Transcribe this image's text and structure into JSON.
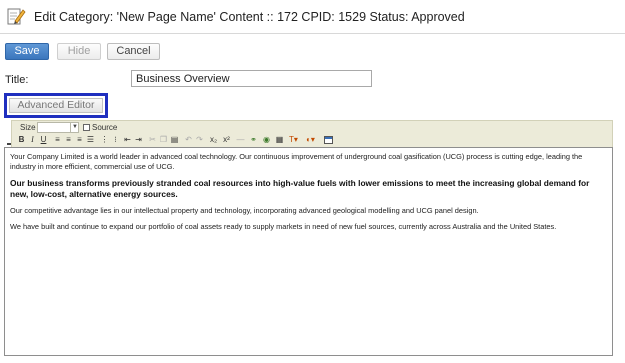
{
  "header": {
    "title": "Edit Category: 'New Page Name' Content :: 172 CPID: 1529 Status: Approved",
    "icon": "edit-page-icon"
  },
  "actions": {
    "save_label": "Save",
    "hide_label": "Hide",
    "cancel_label": "Cancel"
  },
  "form": {
    "title_label": "Title:",
    "title_value": "Business Overview",
    "advanced_editor_label": "Advanced Editor",
    "advanced_editor_highlight_color": "#1f2fbf"
  },
  "toolbar": {
    "size_label": "Size",
    "size_value": "",
    "source_label": "Source",
    "icons": [
      "bold-icon",
      "italic-icon",
      "underline-icon",
      "align-left-icon",
      "align-center-icon",
      "align-right-icon",
      "justify-icon",
      "ordered-list-icon",
      "unordered-list-icon",
      "outdent-icon",
      "indent-icon",
      "cut-icon",
      "copy-icon",
      "paste-icon",
      "undo-icon",
      "redo-icon",
      "subscript-icon",
      "superscript-icon",
      "horizontal-rule-icon",
      "link-icon",
      "image-icon",
      "table-icon",
      "text-color-icon",
      "background-color-icon",
      "maximize-icon"
    ]
  },
  "editor": {
    "paragraphs": [
      {
        "text": "Your Company Limited is a world leader in advanced coal technology. Our continuous improvement of underground coal gasification (UCG) process is cutting edge, leading the industry in more efficient, commercial use of UCG.",
        "bold": false
      },
      {
        "text": "Our business transforms previously stranded coal resources into high-value fuels with lower emissions to meet the increasing global demand for new, low-cost, alternative energy sources.",
        "bold": true
      },
      {
        "text": "Our competitive advantage lies in our intellectual property and technology, incorporating advanced geological modelling and UCG panel design.",
        "bold": false
      },
      {
        "text": "We have built and continue to expand our portfolio of coal assets ready to supply markets in need of new fuel sources, currently across Australia and the United States.",
        "bold": false
      }
    ]
  },
  "colors": {
    "save_button": "#3b76bd",
    "toolbar_bg": "#ecebd9"
  }
}
